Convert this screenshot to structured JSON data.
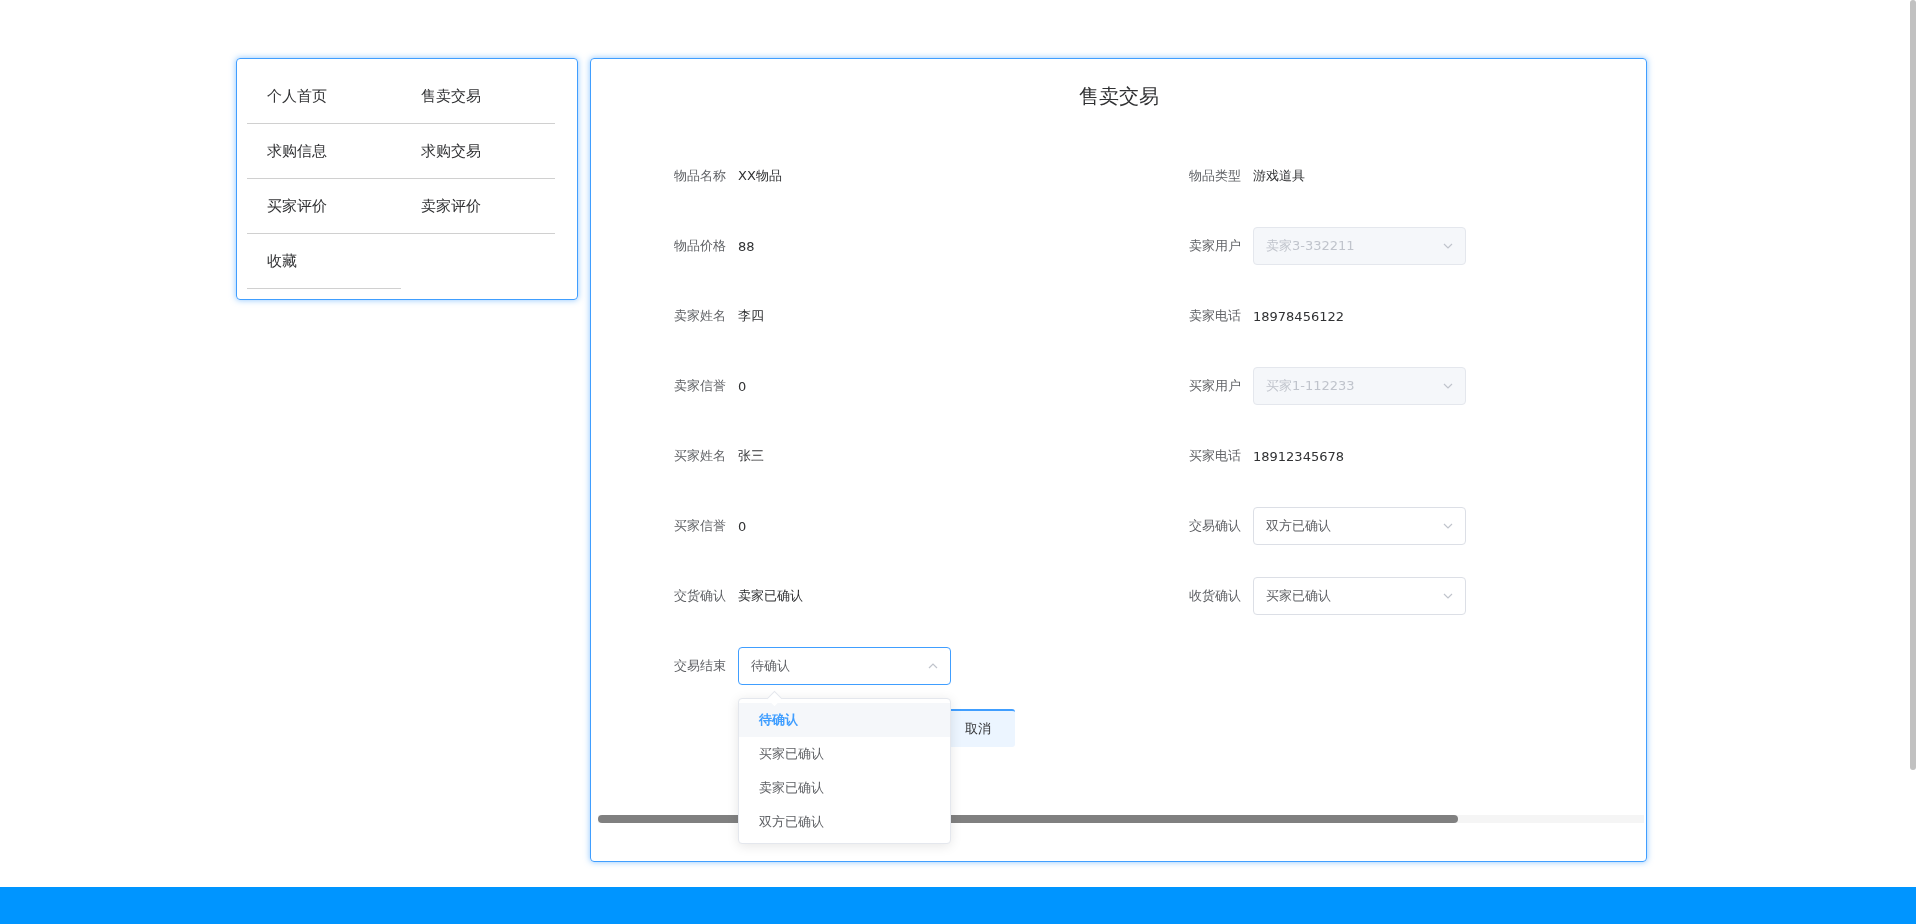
{
  "menu": [
    {
      "label": "个人首页"
    },
    {
      "label": "售卖交易"
    },
    {
      "label": "求购信息"
    },
    {
      "label": "求购交易"
    },
    {
      "label": "买家评价"
    },
    {
      "label": "卖家评价"
    },
    {
      "label": "收藏"
    }
  ],
  "form": {
    "title": "售卖交易",
    "fields": [
      {
        "label": "物品名称",
        "kind": "text",
        "value": "XX物品"
      },
      {
        "label": "物品类型",
        "kind": "text",
        "value": "游戏道具"
      },
      {
        "label": "物品价格",
        "kind": "text",
        "value": "88"
      },
      {
        "label": "卖家用户",
        "kind": "select",
        "value": "卖家3-332211",
        "disabled": true,
        "expanded": false
      },
      {
        "label": "卖家姓名",
        "kind": "text",
        "value": "李四"
      },
      {
        "label": "卖家电话",
        "kind": "text",
        "value": "18978456122"
      },
      {
        "label": "卖家信誉",
        "kind": "text",
        "value": "0"
      },
      {
        "label": "买家用户",
        "kind": "select",
        "value": "买家1-112233",
        "disabled": true,
        "expanded": false
      },
      {
        "label": "买家姓名",
        "kind": "text",
        "value": "张三"
      },
      {
        "label": "买家电话",
        "kind": "text",
        "value": "18912345678"
      },
      {
        "label": "买家信誉",
        "kind": "text",
        "value": "0"
      },
      {
        "label": "交易确认",
        "kind": "select",
        "value": "双方已确认",
        "disabled": false,
        "expanded": false
      },
      {
        "label": "交货确认",
        "kind": "text",
        "value": "卖家已确认"
      },
      {
        "label": "收货确认",
        "kind": "select",
        "value": "买家已确认",
        "disabled": false,
        "expanded": false
      },
      {
        "label": "交易结束",
        "kind": "select",
        "value": "待确认",
        "disabled": false,
        "expanded": true
      }
    ],
    "dropdown": [
      {
        "label": "待确认",
        "selected": true
      },
      {
        "label": "买家已确认",
        "selected": false
      },
      {
        "label": "卖家已确认",
        "selected": false
      },
      {
        "label": "双方已确认",
        "selected": false
      }
    ],
    "cancel_button": "取消"
  }
}
